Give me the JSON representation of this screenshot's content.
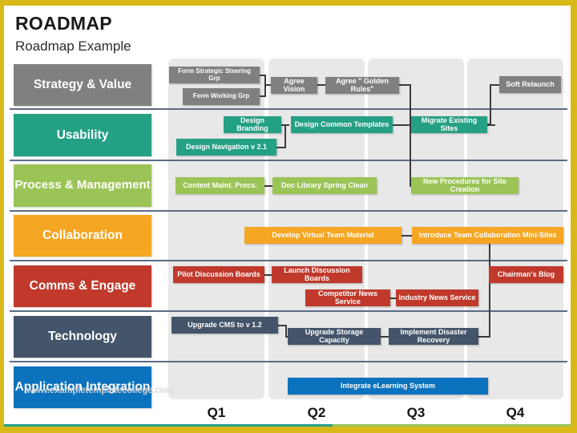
{
  "header": {
    "title": "ROADMAP",
    "subtitle": "Roadmap Example"
  },
  "colors": {
    "frame": "#D9B919",
    "band": "#E8E8E8",
    "separator": "#5B6B86",
    "gray": "#808080",
    "teal": "#24A085",
    "green": "#9BC457",
    "orange": "#F5A623",
    "red": "#C0392B",
    "navy": "#44546A",
    "blue": "#0B72BD",
    "connector": "#3C3C3C"
  },
  "lanes": [
    {
      "label": "Strategy & Value",
      "color": "#808080"
    },
    {
      "label": "Usability",
      "color": "#24A085"
    },
    {
      "label": "Process & Management",
      "color": "#9BC457"
    },
    {
      "label": "Collaboration",
      "color": "#F5A623"
    },
    {
      "label": "Comms & Engage",
      "color": "#C0392B"
    },
    {
      "label": "Technology",
      "color": "#44546A"
    },
    {
      "label": "Application Integration",
      "color": "#0B72BD"
    }
  ],
  "quarters": [
    {
      "label": "Q1"
    },
    {
      "label": "Q2"
    },
    {
      "label": "Q3"
    },
    {
      "label": "Q4"
    }
  ],
  "tasks": [
    {
      "lane": "Strategy & Value",
      "label": "Form Strategic Steering Grp",
      "quarter": "Q1"
    },
    {
      "lane": "Strategy & Value",
      "label": "Form Working Grp",
      "quarter": "Q1"
    },
    {
      "lane": "Strategy & Value",
      "label": "Agree Vision",
      "quarter": "Q2"
    },
    {
      "lane": "Strategy & Value",
      "label": "Agree \" Golden Rules\"",
      "quarter": "Q2"
    },
    {
      "lane": "Strategy & Value",
      "label": "Soft Relaunch",
      "quarter": "Q4"
    },
    {
      "lane": "Usability",
      "label": "Design Branding",
      "quarter": "Q1"
    },
    {
      "lane": "Usability",
      "label": "Design Navigation v 2.1",
      "quarter": "Q1"
    },
    {
      "lane": "Usability",
      "label": "Design Common Templates",
      "quarter": "Q2"
    },
    {
      "lane": "Usability",
      "label": "Migrate Existing Sites",
      "quarter": "Q3"
    },
    {
      "lane": "Process & Management",
      "label": "Content Maint. Procs.",
      "quarter": "Q1"
    },
    {
      "lane": "Process & Management",
      "label": "Doc Library Spring Clean",
      "quarter": "Q2"
    },
    {
      "lane": "Process & Management",
      "label": "New Procedures for Site Creation",
      "quarter": "Q3"
    },
    {
      "lane": "Collaboration",
      "label": "Develop Virtual Team Material",
      "quarter": "Q2"
    },
    {
      "lane": "Collaboration",
      "label": "Introduce Team Collaboration Mini-Sites",
      "quarter": "Q3"
    },
    {
      "lane": "Comms & Engage",
      "label": "Pilot Discussion Boards",
      "quarter": "Q1"
    },
    {
      "lane": "Comms & Engage",
      "label": "Launch Discussion Boards",
      "quarter": "Q2"
    },
    {
      "lane": "Comms & Engage",
      "label": "Competitor News Service",
      "quarter": "Q2"
    },
    {
      "lane": "Comms & Engage",
      "label": "Industry News Service",
      "quarter": "Q3"
    },
    {
      "lane": "Comms & Engage",
      "label": "Chairman's Blog",
      "quarter": "Q4"
    },
    {
      "lane": "Technology",
      "label": "Upgrade CMS to v 1.2",
      "quarter": "Q1"
    },
    {
      "lane": "Technology",
      "label": "Upgrade Storage Capacity",
      "quarter": "Q2"
    },
    {
      "lane": "Technology",
      "label": "Implement Disaster Recovery",
      "quarter": "Q3"
    },
    {
      "lane": "Application Integration",
      "label": "Integrate eLearning System",
      "quarter": "Q2"
    }
  ],
  "watermark": "www.exampletemplatecollege.com"
}
